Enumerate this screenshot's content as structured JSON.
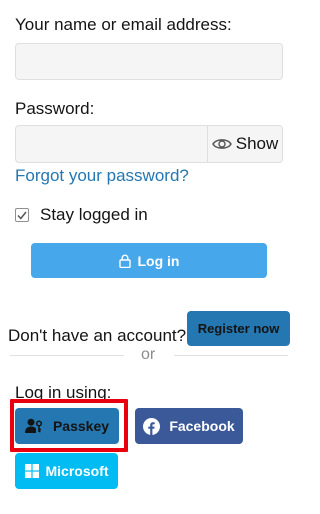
{
  "login_form": {
    "username_label": "Your name or email address:",
    "username_value": "",
    "password_label": "Password:",
    "password_value": "",
    "show_password_label": "Show",
    "forgot_password_link": "Forgot your password?",
    "stay_logged_in_label": "Stay logged in",
    "stay_logged_in_checked": true,
    "login_button_label": "Log in"
  },
  "register": {
    "prompt": "Don't have an account?",
    "button_label": "Register now",
    "divider_text": "or"
  },
  "social_login": {
    "heading": "Log in using:",
    "providers": [
      {
        "name": "Passkey",
        "color": "#2577b1",
        "icon": "passkey-user-key-icon"
      },
      {
        "name": "Facebook",
        "color": "#3b5998",
        "icon": "facebook-icon"
      },
      {
        "name": "Microsoft",
        "color": "#00bcf2",
        "icon": "microsoft-windows-icon"
      }
    ]
  },
  "colors": {
    "accent": "#2577b1",
    "login_button": "#47a7eb",
    "highlight_border": "#e8000f"
  }
}
